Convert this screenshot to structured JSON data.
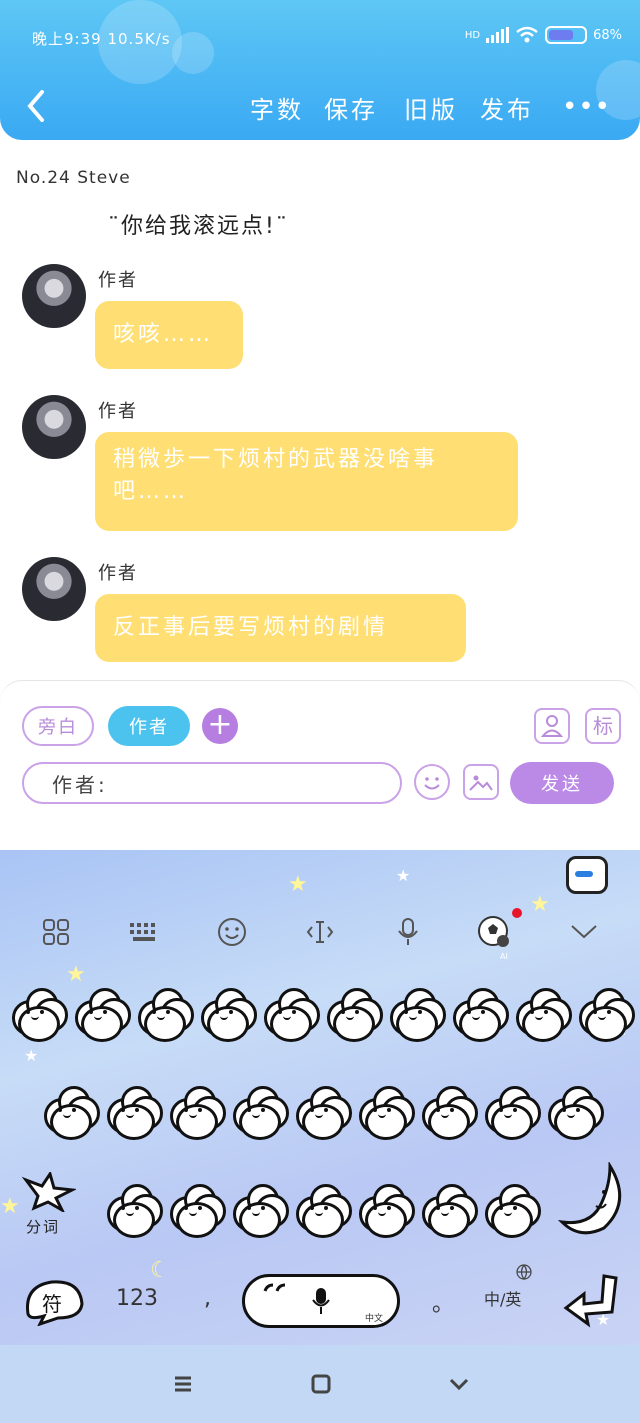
{
  "status_bar": {
    "time": "晚上9:39",
    "speed": "10.5K/s",
    "hd": "HD",
    "battery": "68%"
  },
  "toolbar": {
    "back_icon": "chevron-left-icon",
    "word_count": "字数",
    "save": "保存",
    "old_version": "旧版",
    "publish": "发布",
    "more": "•••"
  },
  "chat": {
    "chapter": "No.24  Steve",
    "quote": "¨你给我滚远点!¨",
    "messages": [
      {
        "author": "作者",
        "text": "咳咳……"
      },
      {
        "author": "作者",
        "text": "稍微歩一下烦村的武器没啥事吧……"
      },
      {
        "author": "作者",
        "text": "反正事后要写烦村的剧情"
      }
    ]
  },
  "editor": {
    "role_narration": "旁白",
    "role_author": "作者",
    "add_role": "+",
    "mark_label": "标",
    "input_value": "作者:",
    "send": "发送"
  },
  "keyboard": {
    "segment_label": "分词",
    "symbol_key": "符",
    "numbers_key": "123",
    "comma_key": ",",
    "period_key": "。",
    "lang_key": "中/英",
    "space_caption": "中文",
    "ai_badge": "AI",
    "accent_star": "#fff176"
  },
  "colors": {
    "header": "#3aa9f3",
    "bubble": "#ffdf74",
    "accent_purple": "#bb8ae6",
    "author_blue": "#4cc3ee"
  }
}
